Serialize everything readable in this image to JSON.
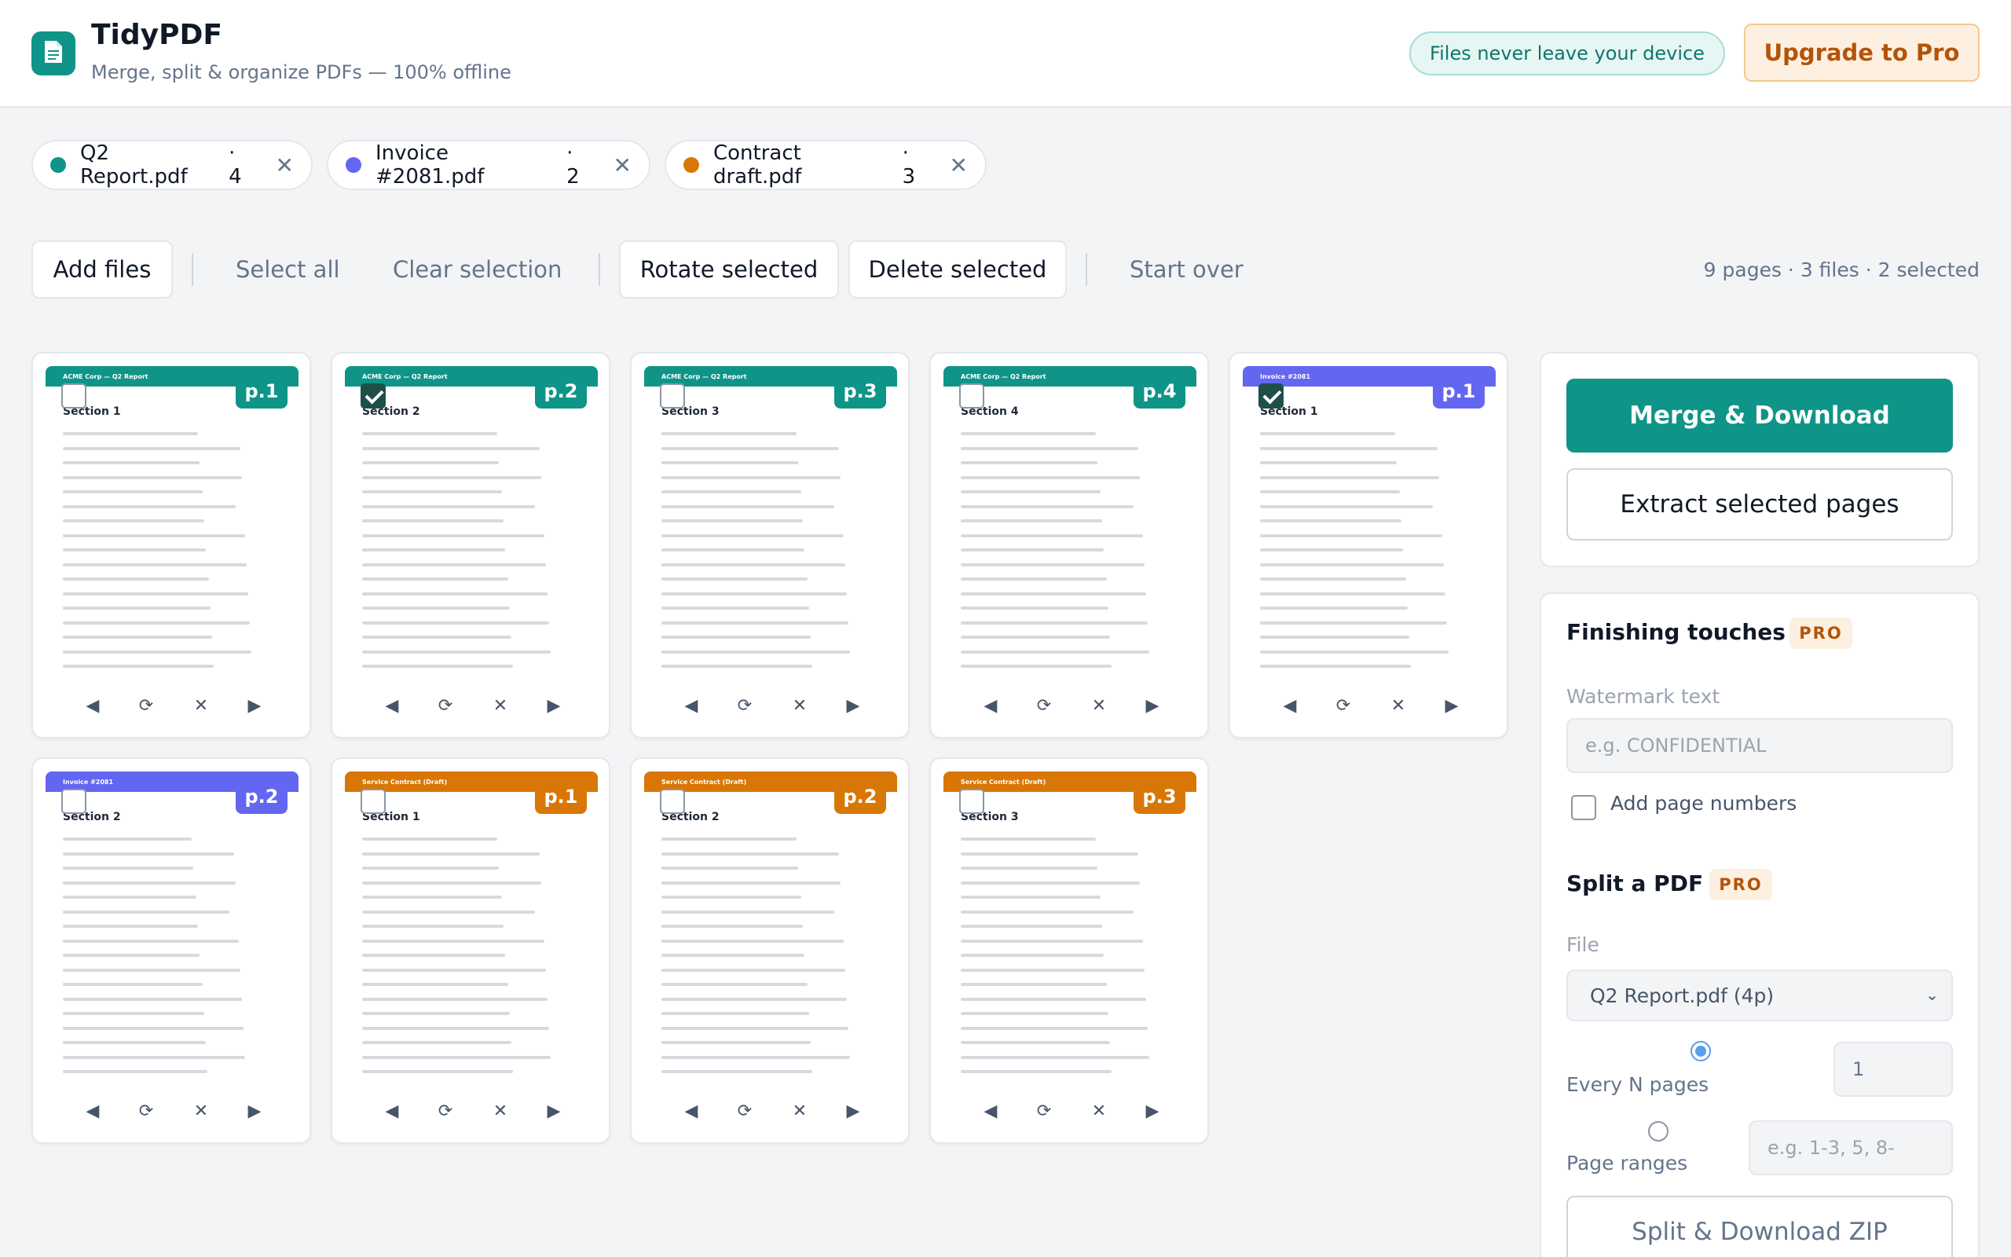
{
  "app": {
    "title": "TidyPDF",
    "subtitle": "Merge, split & organize PDFs — 100% offline",
    "privacy_badge": "Files never leave your device",
    "upgrade_label": "Upgrade to Pro"
  },
  "files": [
    {
      "name": "Q2 Report.pdf",
      "count": "· 4",
      "color": "#0f9488",
      "close": "✕"
    },
    {
      "name": "Invoice #2081.pdf",
      "count": "· 2",
      "color": "#6366f1",
      "close": "✕"
    },
    {
      "name": "Contract draft.pdf",
      "count": "· 3",
      "color": "#d97706",
      "close": "✕"
    }
  ],
  "toolbar": {
    "add_files": "Add files",
    "select_all": "Select all",
    "clear_selection": "Clear selection",
    "rotate_selected": "Rotate selected",
    "delete_selected": "Delete selected",
    "start_over": "Start over",
    "stats": "9 pages · 3 files · 2 selected"
  },
  "pages": [
    {
      "doc_title": "ACME Corp — Q2 Report",
      "section": "Section 1",
      "badge": "p.1",
      "color": "#0f9488",
      "selected": false
    },
    {
      "doc_title": "ACME Corp — Q2 Report",
      "section": "Section 2",
      "badge": "p.2",
      "color": "#0f9488",
      "selected": true
    },
    {
      "doc_title": "ACME Corp — Q2 Report",
      "section": "Section 3",
      "badge": "p.3",
      "color": "#0f9488",
      "selected": false
    },
    {
      "doc_title": "ACME Corp — Q2 Report",
      "section": "Section 4",
      "badge": "p.4",
      "color": "#0f9488",
      "selected": false
    },
    {
      "doc_title": "Invoice #2081",
      "section": "Section 1",
      "badge": "p.1",
      "color": "#6366f1",
      "selected": true
    },
    {
      "doc_title": "Invoice #2081",
      "section": "Section 2",
      "badge": "p.2",
      "color": "#6366f1",
      "selected": false
    },
    {
      "doc_title": "Service Contract (Draft)",
      "section": "Section 1",
      "badge": "p.1",
      "color": "#d97706",
      "selected": false
    },
    {
      "doc_title": "Service Contract (Draft)",
      "section": "Section 2",
      "badge": "p.2",
      "color": "#d97706",
      "selected": false
    },
    {
      "doc_title": "Service Contract (Draft)",
      "section": "Section 3",
      "badge": "p.3",
      "color": "#d97706",
      "selected": false
    }
  ],
  "page_controls": {
    "move_left": "◀",
    "rotate": "⟳",
    "remove": "✕",
    "move_right": "▶"
  },
  "actions": {
    "merge": "Merge & Download",
    "extract": "Extract selected pages"
  },
  "finishing": {
    "title": "Finishing touches",
    "pro_badge": "PRO",
    "watermark_label": "Watermark text",
    "watermark_value": "",
    "watermark_placeholder": "e.g. CONFIDENTIAL",
    "page_numbers_label": "Add page numbers"
  },
  "split": {
    "title": "Split a PDF",
    "pro_badge": "PRO",
    "file_label": "File",
    "file_selected": "Q2 Report.pdf (4p)",
    "every_n_label": "Every N pages",
    "every_n_value": "1",
    "ranges_label": "Page ranges",
    "ranges_placeholder": "e.g. 1-3, 5, 8-",
    "split_button": "Split & Download ZIP"
  }
}
